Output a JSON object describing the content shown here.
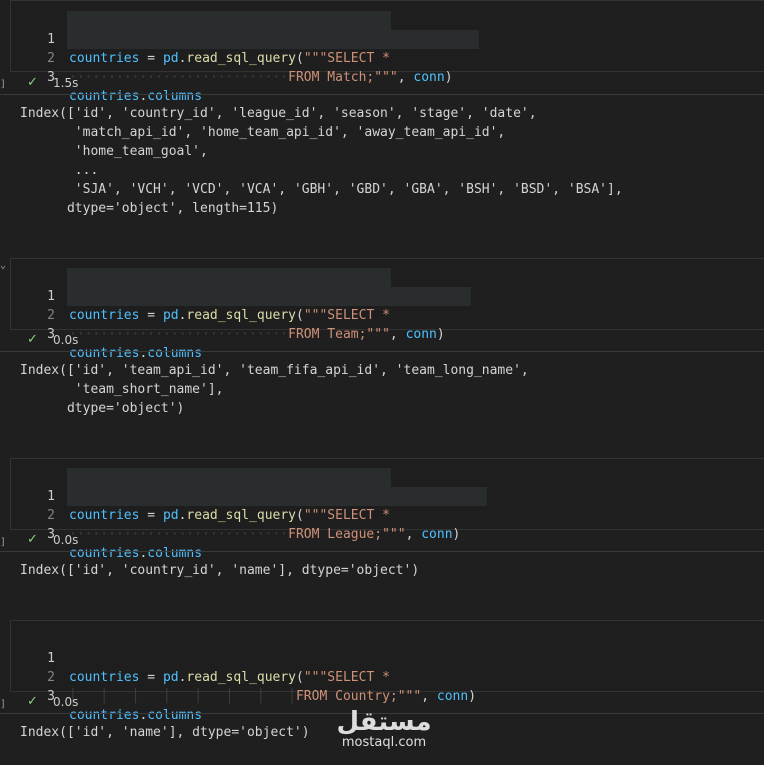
{
  "cells": [
    {
      "lines": [
        {
          "num": "1",
          "a": "countries",
          "b": " = ",
          "c": "pd",
          "d": ".",
          "e": "read_sql_query",
          "f": "(",
          "g": "\"\"\"SELECT *"
        },
        {
          "num": "2",
          "dots": "····························",
          "g": "FROM Match;\"\"\"",
          "h": ", ",
          "i": "conn",
          "j": ")"
        },
        {
          "num": "3",
          "a": "countries",
          "d": ".",
          "k": "columns"
        }
      ],
      "time": "1.5s",
      "output": "Index(['id', 'country_id', 'league_id', 'season', 'stage', 'date',\n       'match_api_id', 'home_team_api_id', 'away_team_api_id',\n       'home_team_goal',\n       ...\n       'SJA', 'VCH', 'VCD', 'VCA', 'GBH', 'GBD', 'GBA', 'BSH', 'BSD', 'BSA'],\n      dtype='object', length=115)"
    },
    {
      "lines": [
        {
          "num": "1",
          "a": "countries",
          "b": " = ",
          "c": "pd",
          "d": ".",
          "e": "read_sql_query",
          "f": "(",
          "g": "\"\"\"SELECT *"
        },
        {
          "num": "2",
          "dots": "····························",
          "g": "FROM Team;\"\"\"",
          "h": ", ",
          "i": "conn",
          "j": ")"
        },
        {
          "num": "3",
          "a": "countries",
          "d": ".",
          "k": "columns"
        }
      ],
      "time": "0.0s",
      "output": "Index(['id', 'team_api_id', 'team_fifa_api_id', 'team_long_name',\n       'team_short_name'],\n      dtype='object')"
    },
    {
      "lines": [
        {
          "num": "1",
          "a": "countries",
          "b": " = ",
          "c": "pd",
          "d": ".",
          "e": "read_sql_query",
          "f": "(",
          "g": "\"\"\"SELECT *"
        },
        {
          "num": "2",
          "dots": "····························",
          "g": "FROM League;\"\"\"",
          "h": ", ",
          "i": "conn",
          "j": ")"
        },
        {
          "num": "3",
          "a": "countries",
          "d": ".",
          "k": "columns"
        }
      ],
      "time": "0.0s",
      "output": "Index(['id', 'country_id', 'name'], dtype='object')"
    },
    {
      "lines": [
        {
          "num": "1",
          "a": "countries",
          "b": " = ",
          "c": "pd",
          "d": ".",
          "e": "read_sql_query",
          "f": "(",
          "g": "\"\"\"SELECT *"
        },
        {
          "num": "2",
          "dots": "│   │   │   │   │   │   │   │",
          "g": "FROM Country;\"\"\"",
          "h": ", ",
          "i": "conn",
          "j": ")"
        },
        {
          "num": "3",
          "a": "countries",
          "d": ".",
          "k": "columns"
        }
      ],
      "time": "0.0s",
      "output": "Index(['id', 'name'], dtype='object')"
    }
  ],
  "watermark": {
    "arabic": "مستقل",
    "latin": "mostaql.com"
  },
  "colors": {
    "variable": "#4fc1ff",
    "function": "#dcdcaa",
    "string": "#ce9178",
    "success": "#89d185"
  }
}
